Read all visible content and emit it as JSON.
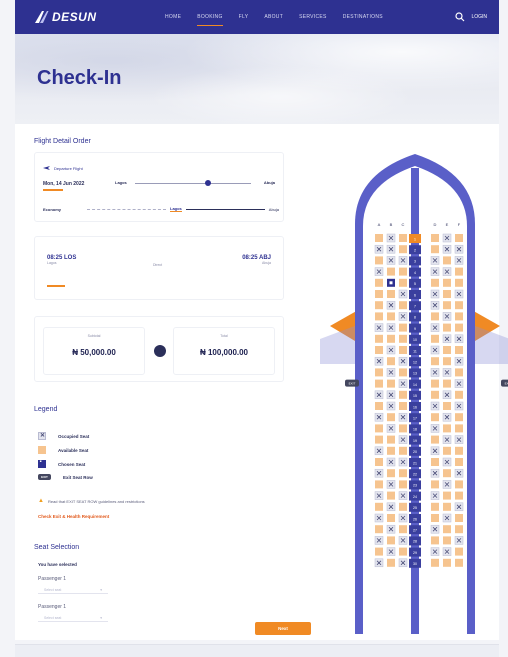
{
  "nav": {
    "brand": "DESUN",
    "links": [
      "HOME",
      "BOOKING",
      "FLY",
      "ABOUT",
      "SERVICES",
      "DESTINATIONS"
    ],
    "active_index": 1,
    "login": "LOGIN"
  },
  "hero": {
    "title": "Check-In"
  },
  "flight": {
    "section_title": "Flight Detail Order",
    "departure_label": "Departure Flight",
    "date": "Mon, 14 Jun 2022",
    "from": "Lagos",
    "to": "Abuja",
    "row_left": "Economy",
    "row_mid": "Lagos",
    "row_right": "Abuja"
  },
  "times": {
    "dep_time": "08:25 LOS",
    "dep_city": "Lagos",
    "arr_time": "08:25 ABJ",
    "arr_city": "Abuja",
    "mid": "Direct"
  },
  "prices": {
    "a_label": "Subtotal",
    "a_value": "₦ 50,000.00",
    "b_label": "Total",
    "b_value": "₦ 100,000.00"
  },
  "legend": {
    "title": "Legend",
    "items": [
      "Occupied Seat",
      "Available Seat",
      "Chosen Seat",
      "Exit Seat Row"
    ],
    "warning": "Read that EXIT SEAT ROW guidelines and restrictions",
    "link": "Check Exit & Health Requirement"
  },
  "seat_selection": {
    "title": "Seat Selection",
    "selected_label": "You have selected",
    "passengers": [
      {
        "label": "Passenger 1",
        "placeholder": "Select seat"
      },
      {
        "label": "Passenger 1",
        "placeholder": "Select seat"
      }
    ],
    "next": "Next"
  },
  "seatmap": {
    "column_letters": [
      "A",
      "B",
      "C",
      "D",
      "E",
      "F"
    ],
    "rows": 30,
    "occupied": [
      [
        1,
        2
      ],
      [
        1,
        5
      ],
      [
        2,
        1
      ],
      [
        2,
        2
      ],
      [
        2,
        5
      ],
      [
        2,
        6
      ],
      [
        3,
        2
      ],
      [
        3,
        3
      ],
      [
        3,
        4
      ],
      [
        3,
        6
      ],
      [
        4,
        1
      ],
      [
        4,
        4
      ],
      [
        4,
        5
      ],
      [
        6,
        3
      ],
      [
        6,
        4
      ],
      [
        6,
        6
      ],
      [
        7,
        2
      ],
      [
        7,
        4
      ],
      [
        8,
        3
      ],
      [
        8,
        5
      ],
      [
        9,
        1
      ],
      [
        9,
        2
      ],
      [
        9,
        4
      ],
      [
        10,
        5
      ],
      [
        10,
        6
      ],
      [
        11,
        2
      ],
      [
        11,
        4
      ],
      [
        12,
        1
      ],
      [
        12,
        3
      ],
      [
        12,
        6
      ],
      [
        13,
        2
      ],
      [
        13,
        4
      ],
      [
        13,
        5
      ],
      [
        14,
        3
      ],
      [
        14,
        6
      ],
      [
        15,
        1
      ],
      [
        15,
        2
      ],
      [
        15,
        5
      ],
      [
        16,
        2
      ],
      [
        16,
        4
      ],
      [
        16,
        6
      ],
      [
        17,
        1
      ],
      [
        17,
        3
      ],
      [
        17,
        5
      ],
      [
        18,
        2
      ],
      [
        18,
        4
      ],
      [
        19,
        3
      ],
      [
        19,
        5
      ],
      [
        19,
        6
      ],
      [
        20,
        1
      ],
      [
        20,
        4
      ],
      [
        21,
        2
      ],
      [
        21,
        3
      ],
      [
        21,
        5
      ],
      [
        22,
        1
      ],
      [
        22,
        4
      ],
      [
        22,
        6
      ],
      [
        23,
        2
      ],
      [
        23,
        5
      ],
      [
        24,
        1
      ],
      [
        24,
        3
      ],
      [
        24,
        4
      ],
      [
        25,
        2
      ],
      [
        25,
        6
      ],
      [
        26,
        1
      ],
      [
        26,
        3
      ],
      [
        26,
        5
      ],
      [
        27,
        2
      ],
      [
        27,
        4
      ],
      [
        28,
        1
      ],
      [
        28,
        3
      ],
      [
        28,
        6
      ],
      [
        29,
        2
      ],
      [
        29,
        4
      ],
      [
        29,
        5
      ],
      [
        30,
        1
      ],
      [
        30,
        3
      ]
    ],
    "chosen": [
      [
        5,
        2
      ]
    ],
    "exit_label": "EXIT",
    "exit_row": 14
  }
}
